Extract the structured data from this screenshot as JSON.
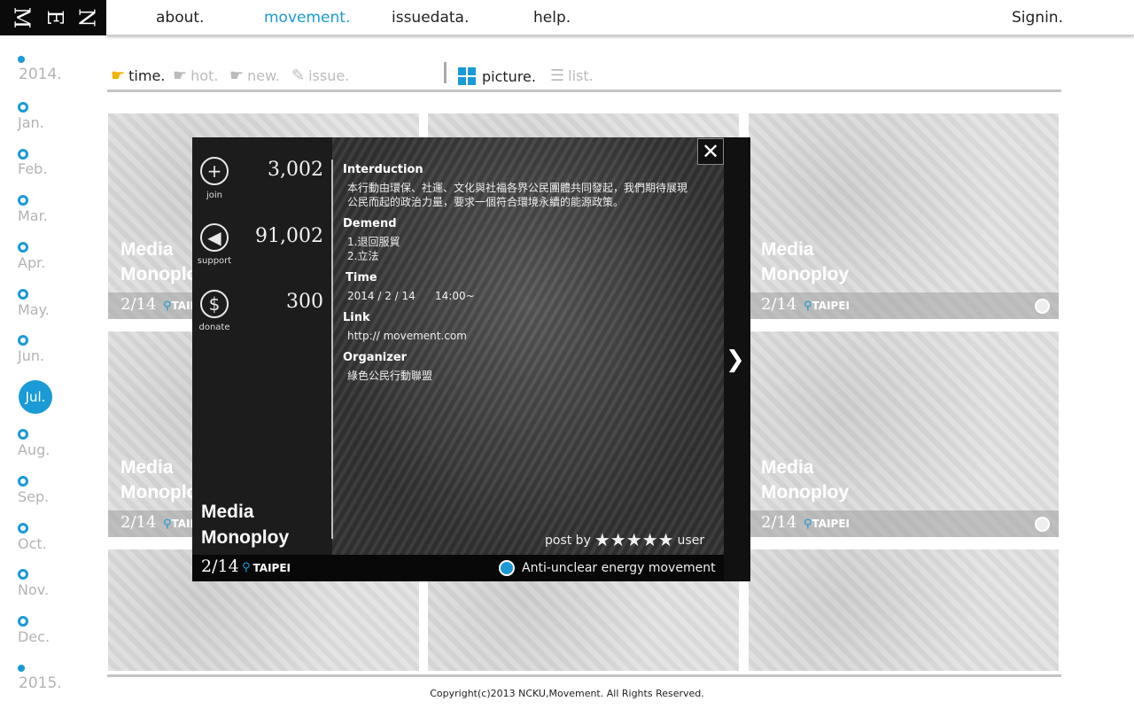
{
  "logo": [
    "M",
    "E",
    "N"
  ],
  "nav": {
    "about": "about.",
    "movement": "movement.",
    "issuedata": "issuedata.",
    "help": "help.",
    "signin": "Signin."
  },
  "timeline": {
    "start_year": "2014.",
    "months": [
      "Jan.",
      "Feb.",
      "Mar.",
      "Apr.",
      "May.",
      "Jun.",
      "Aug.",
      "Sep.",
      "Oct.",
      "Nov.",
      "Dec."
    ],
    "active_month": "Jul.",
    "end_year": "2015."
  },
  "filters": {
    "time": "time.",
    "hot": "hot.",
    "new": "new.",
    "issue": "issue.",
    "picture": "picture.",
    "list": "list."
  },
  "cards": [
    {
      "title1": "Media",
      "title2": "Monoploy",
      "date": "2/14",
      "location": "TAIPEI"
    },
    {
      "title1": "Media",
      "title2": "Monoploy",
      "date": "2/14",
      "location": "TAIPEI"
    },
    {
      "title1": "Media",
      "title2": "Monoploy",
      "date": "2/14",
      "location": "TAIPEI"
    },
    {
      "title1": "Media",
      "title2": "Monoploy",
      "date": "2/14",
      "location": "TAIPEI"
    }
  ],
  "modal": {
    "stats": {
      "join_label": "join",
      "join_count": "3,002",
      "support_label": "support",
      "support_count": "91,002",
      "donate_label": "donate",
      "donate_count": "300"
    },
    "intro_heading": "Interduction",
    "intro_line1": "本行動由環保、社運、文化與社福各界公民團體共同發起，我們期待展現",
    "intro_line2": "公民而起的政治力量，要求一個符合環境永續的能源政策。",
    "demend_heading": "Demend",
    "demend_1": "1.退回服貿",
    "demend_2": "2.立法",
    "time_heading": "Time",
    "time_date": "2014 / 2 / 14",
    "time_clock": "14:00~",
    "link_heading": "Link",
    "link_value": "http:// movement.com",
    "organizer_heading": "Organizer",
    "organizer_value": "綠色公民行動聯盟",
    "title1": "Media",
    "title2": "Monoploy",
    "post_by": "post by",
    "rating": 5,
    "user": "user",
    "date": "2/14",
    "location": "TAIPEI",
    "category": "Anti-unclear energy movement"
  },
  "copyright": "Copyright(c)2013 NCKU,Movement. All Rights Reserved.",
  "colors": {
    "accent": "#1a9ad6",
    "highlight": "#f0b400"
  }
}
